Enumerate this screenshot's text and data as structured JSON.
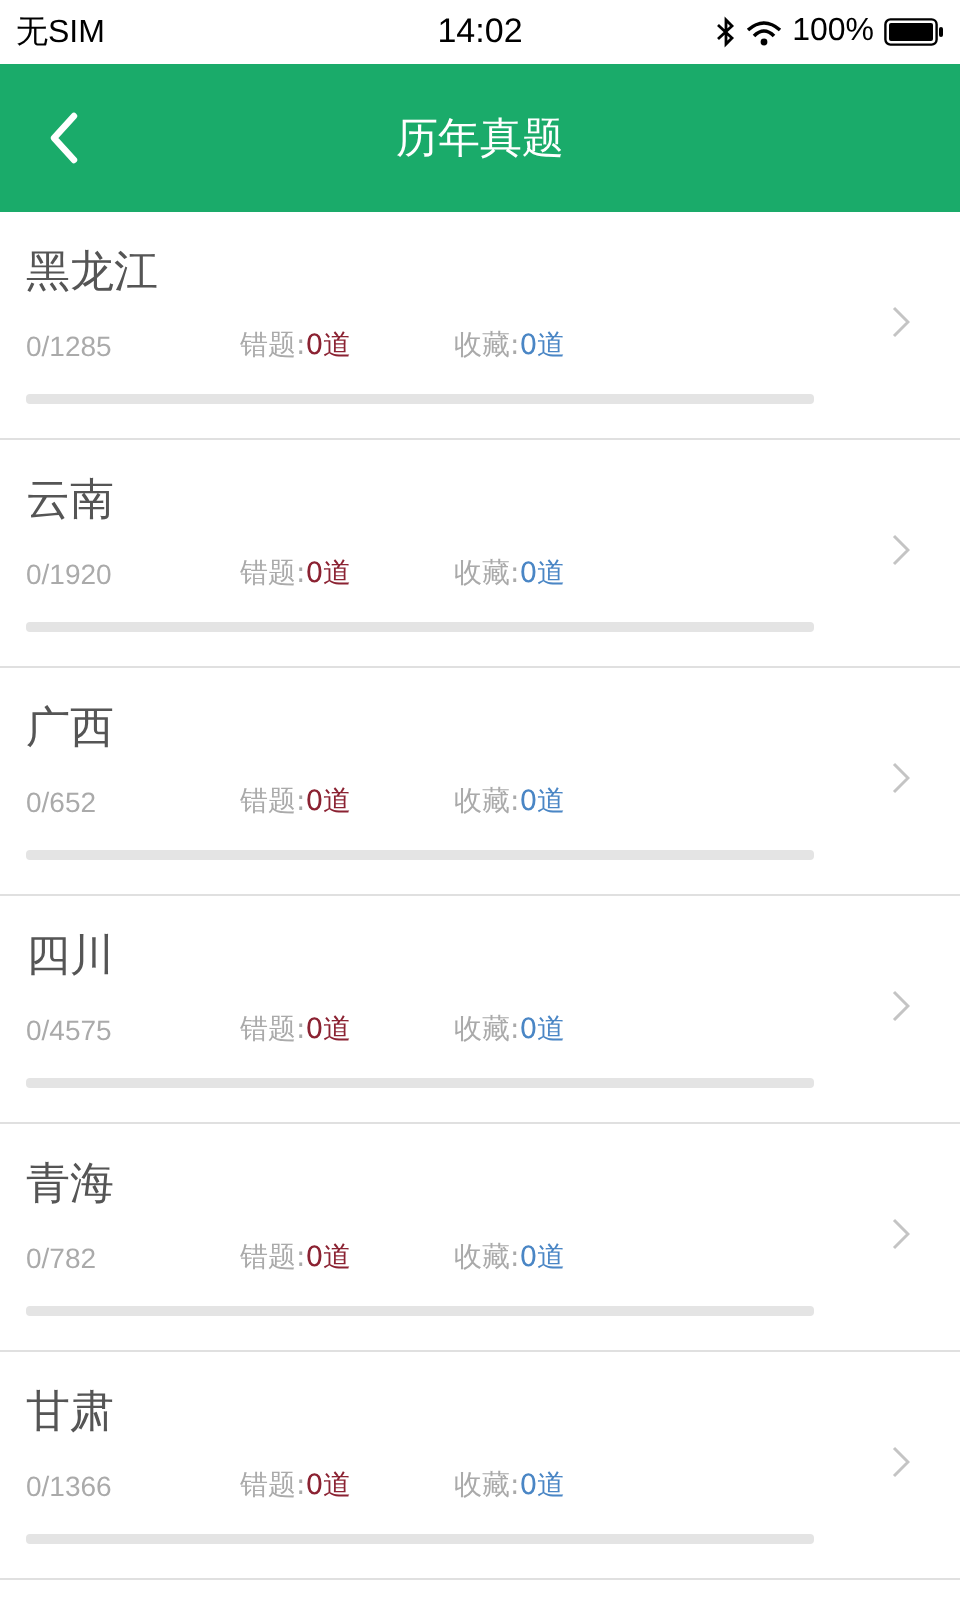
{
  "status_bar": {
    "carrier": "无SIM",
    "time": "14:02",
    "battery": "100%"
  },
  "header": {
    "title": "历年真题"
  },
  "rows": [
    {
      "name": "黑龙江",
      "progress": "0/1285",
      "wrong_label": "错题:",
      "wrong": "0道",
      "fav_label": "收藏:",
      "fav": "0道"
    },
    {
      "name": "云南",
      "progress": "0/1920",
      "wrong_label": "错题:",
      "wrong": "0道",
      "fav_label": "收藏:",
      "fav": "0道"
    },
    {
      "name": "广西",
      "progress": "0/652",
      "wrong_label": "错题:",
      "wrong": "0道",
      "fav_label": "收藏:",
      "fav": "0道"
    },
    {
      "name": "四川",
      "progress": "0/4575",
      "wrong_label": "错题:",
      "wrong": "0道",
      "fav_label": "收藏:",
      "fav": "0道"
    },
    {
      "name": "青海",
      "progress": "0/782",
      "wrong_label": "错题:",
      "wrong": "0道",
      "fav_label": "收藏:",
      "fav": "0道"
    },
    {
      "name": "甘肃",
      "progress": "0/1366",
      "wrong_label": "错题:",
      "wrong": "0道",
      "fav_label": "收藏:",
      "fav": "0道"
    }
  ]
}
